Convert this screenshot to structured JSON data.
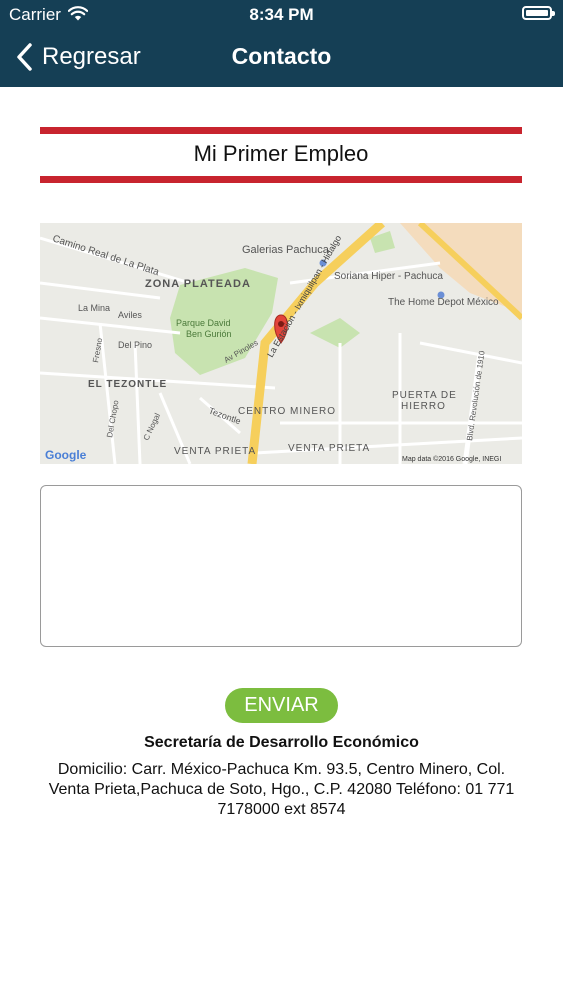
{
  "status_bar": {
    "carrier": "Carrier",
    "time": "8:34 PM"
  },
  "nav": {
    "back_label": "Regresar",
    "title": "Contacto"
  },
  "page": {
    "heading": "Mi Primer Empleo"
  },
  "map": {
    "labels": {
      "camino_real": "Camino Real de La Plata",
      "galerias": "Galerias Pachuca",
      "zona_plateada": "ZONA PLATEADA",
      "soriana": "Soriana Hiper - Pachuca",
      "home_depot": "The Home Depot México",
      "la_mina": "La Mina",
      "aviles": "Aviles",
      "parque_1": "Parque David",
      "parque_2": "Ben Gurión",
      "del_pino": "Del Pino",
      "fresno": "Fresno",
      "av_pinoles": "Av Pinoles",
      "la_estacion": "La Estación - Ixmiquilpan - Hidalgo",
      "el_tezontle": "EL TEZONTLE",
      "puerta_1": "PUERTA DE",
      "puerta_2": "HIERRO",
      "revolucion": "Blvd. Revolución de 1910",
      "del_chopo": "Del Chopo",
      "c_nogal": "C Nogal",
      "tezontle": "Tezontle",
      "centro_minero": "CENTRO MINERO",
      "venta_prieta_1": "VENTA PRIETA",
      "venta_prieta_2": "VENTA PRIETA",
      "google": "Google",
      "attribution": "Map data ©2016 Google, INEGI"
    },
    "colors": {
      "base": "#ebebe6",
      "park": "#c8e3b0",
      "road": "#f6cf5c",
      "orange_area": "#f4dcbd",
      "marker": "#e3443a"
    }
  },
  "form": {
    "message_value": "",
    "send_label": "ENVIAR"
  },
  "contact": {
    "org_name": "Secretaría de Desarrollo Económico",
    "address": "Domicilio: Carr. México-Pachuca Km. 93.5, Centro Minero, Col. Venta Prieta,Pachuca de Soto, Hgo., C.P. 42080 Teléfono: 01 771 7178000 ext 8574"
  },
  "colors": {
    "nav_background": "#153f55",
    "accent_red": "#c8242e",
    "button_green": "#7cbd3f"
  }
}
